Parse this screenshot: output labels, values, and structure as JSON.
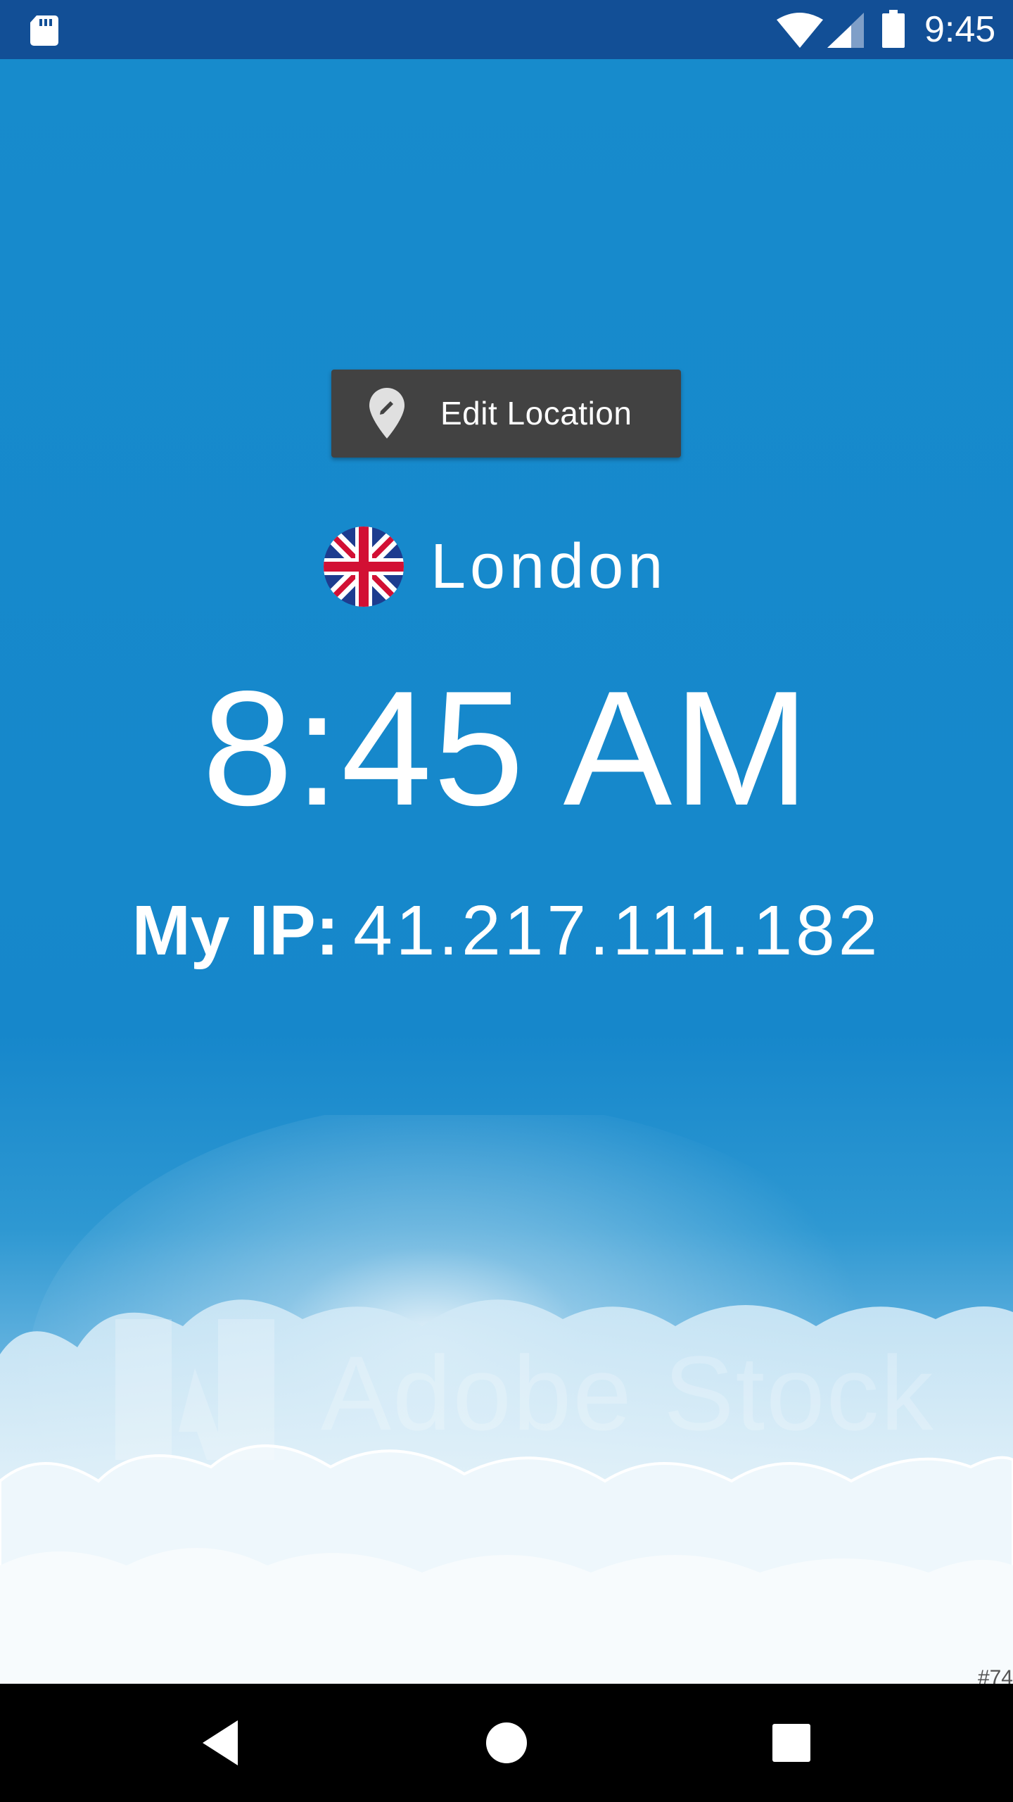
{
  "status_bar": {
    "time": "9:45",
    "icons": [
      "sd-card-icon",
      "wifi-icon",
      "cell-signal-icon",
      "battery-icon"
    ]
  },
  "main": {
    "edit_location_label": "Edit Location",
    "city": "London",
    "flag": "uk-flag-icon",
    "time": "8:45 AM",
    "ip_label": "My IP:",
    "ip_value": "41.217.111.182"
  },
  "background": {
    "watermark": "Adobe Stock",
    "corner_code": "#74"
  },
  "nav_bar": {
    "icons": [
      "back-icon",
      "home-icon",
      "recents-icon"
    ]
  },
  "colors": {
    "status_bar": "#124f96",
    "background": "#1688cb",
    "button": "#424242",
    "text": "#ffffff"
  }
}
